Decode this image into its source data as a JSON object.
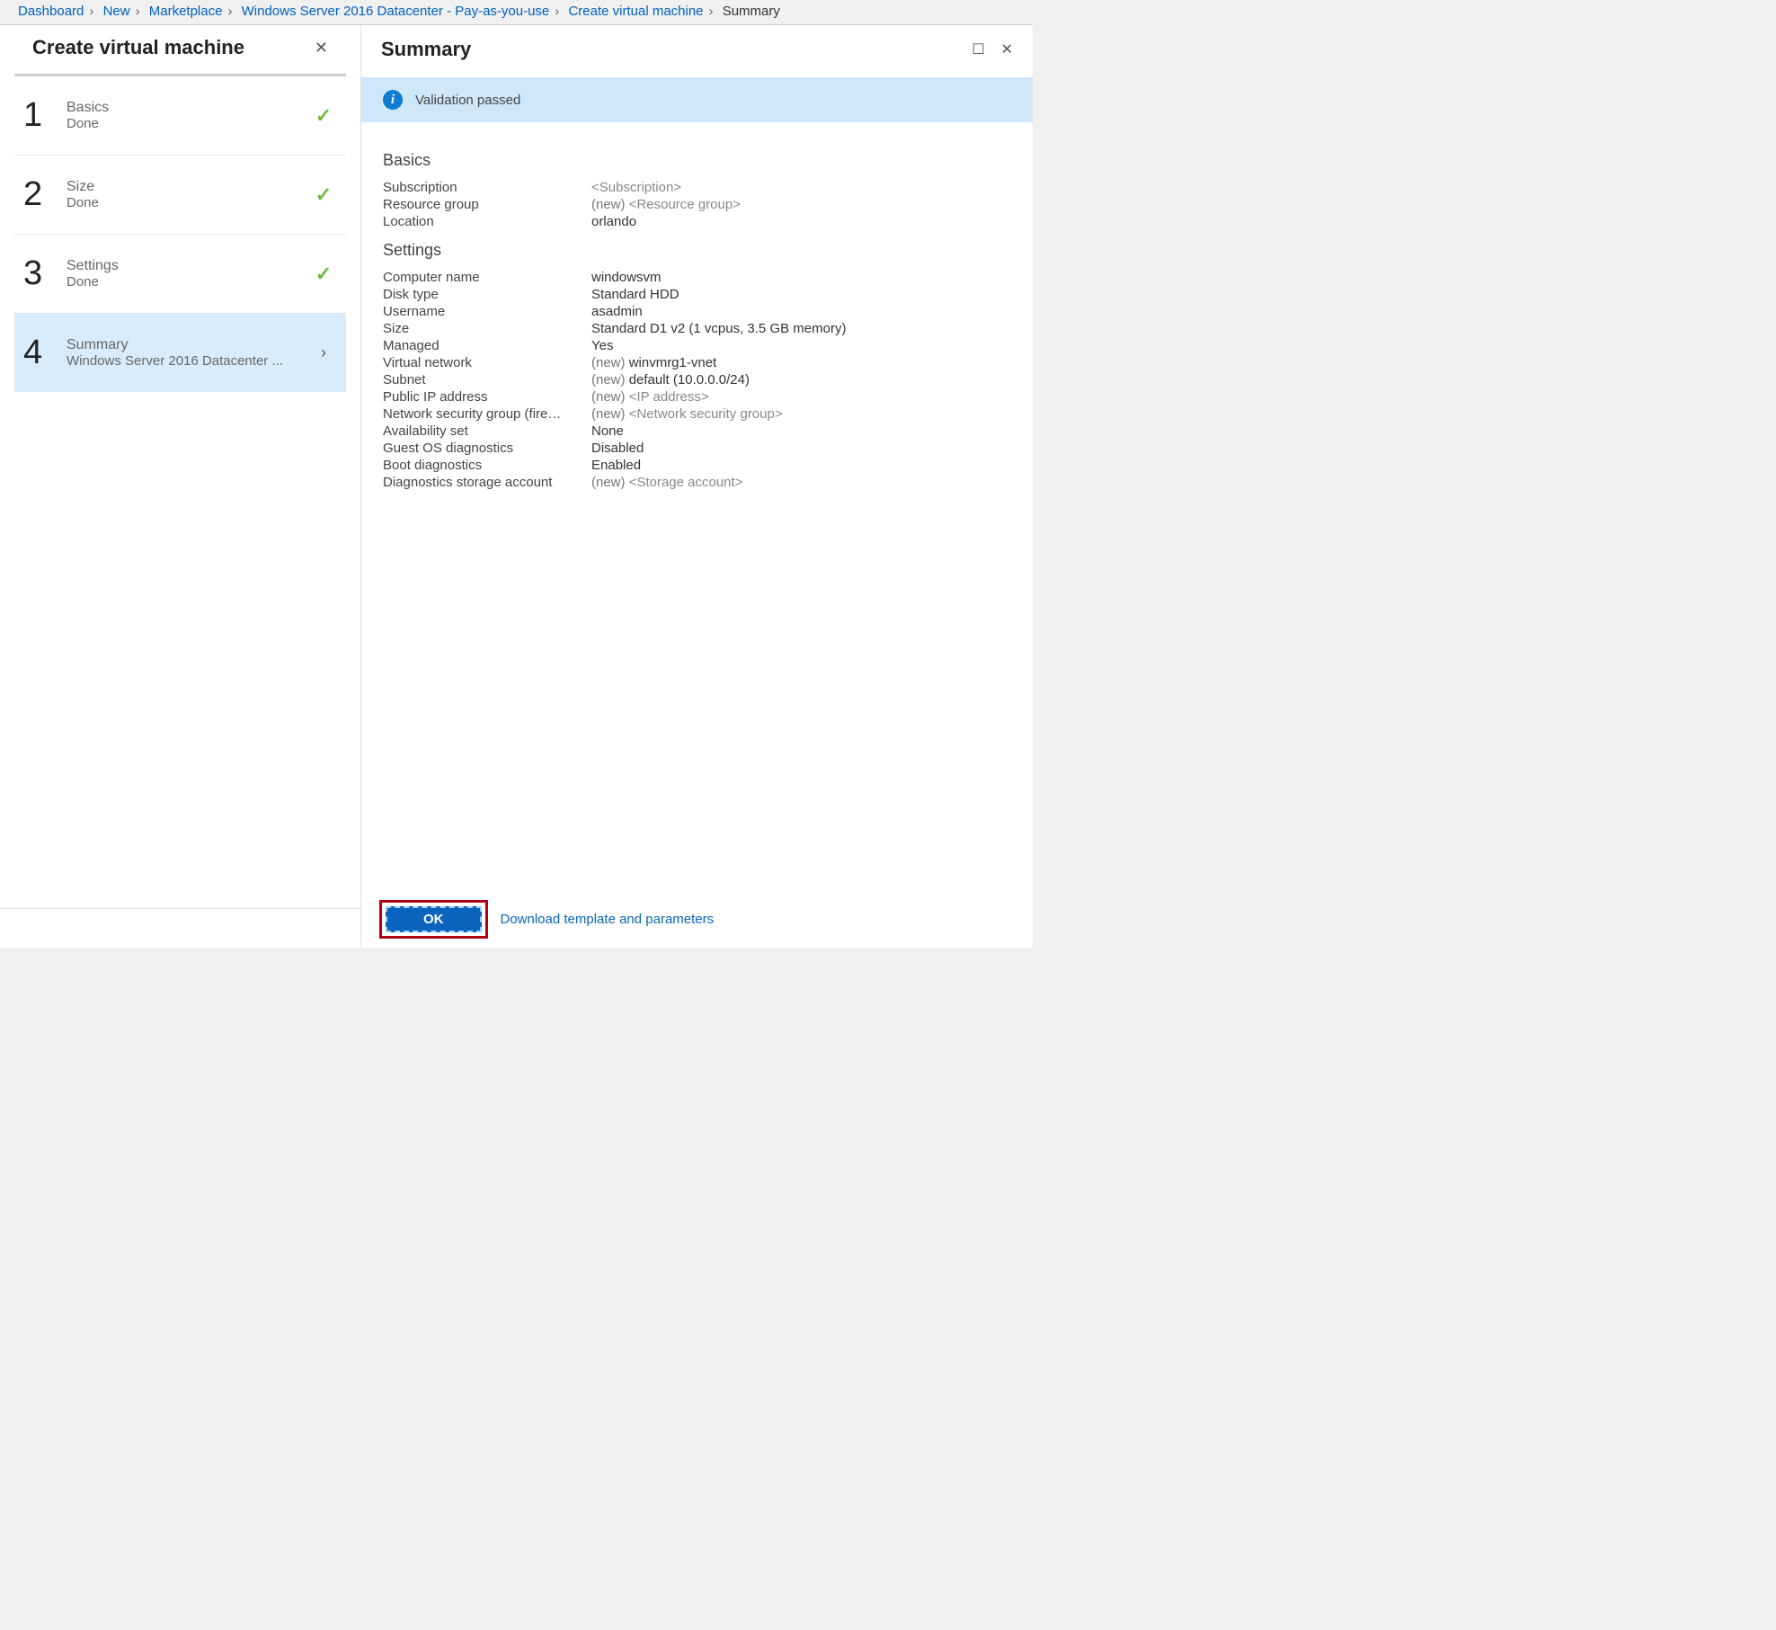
{
  "breadcrumb": {
    "items": [
      "Dashboard",
      "New",
      "Marketplace",
      "Windows Server 2016 Datacenter - Pay-as-you-use",
      "Create virtual machine"
    ],
    "current": "Summary"
  },
  "leftPanel": {
    "title": "Create virtual machine",
    "steps": [
      {
        "num": "1",
        "title": "Basics",
        "sub": "Done",
        "status": "done"
      },
      {
        "num": "2",
        "title": "Size",
        "sub": "Done",
        "status": "done"
      },
      {
        "num": "3",
        "title": "Settings",
        "sub": "Done",
        "status": "done"
      },
      {
        "num": "4",
        "title": "Summary",
        "sub": "Windows Server 2016 Datacenter ...",
        "status": "active"
      }
    ]
  },
  "rightPanel": {
    "title": "Summary",
    "validation": "Validation passed",
    "sections": {
      "basics": {
        "heading": "Basics",
        "rows": [
          {
            "k": "Subscription",
            "v": "<Subscription>",
            "muted": true
          },
          {
            "k": "Resource group",
            "pfx": "(new) ",
            "v": "<Resource group>",
            "muted": true
          },
          {
            "k": "Location",
            "v": "orlando"
          }
        ]
      },
      "settings": {
        "heading": "Settings",
        "rows": [
          {
            "k": "Computer name",
            "v": "windowsvm"
          },
          {
            "k": "Disk type",
            "v": "Standard HDD"
          },
          {
            "k": "Username",
            "v": "asadmin"
          },
          {
            "k": "Size",
            "v": "Standard D1 v2 (1 vcpus, 3.5 GB memory)"
          },
          {
            "k": "Managed",
            "v": "Yes"
          },
          {
            "k": "Virtual network",
            "pfx": "(new) ",
            "v": "winvmrg1-vnet"
          },
          {
            "k": "Subnet",
            "pfx": "(new) ",
            "v": "default (10.0.0.0/24)"
          },
          {
            "k": "Public IP address",
            "pfx": "(new) ",
            "v": "<IP address>",
            "muted": true
          },
          {
            "k": "Network security group (fire…",
            "pfx": "(new) ",
            "v": "<Network security group>",
            "muted": true
          },
          {
            "k": "Availability set",
            "v": "None"
          },
          {
            "k": "Guest OS diagnostics",
            "v": "Disabled"
          },
          {
            "k": "Boot diagnostics",
            "v": "Enabled"
          },
          {
            "k": "Diagnostics storage account",
            "pfx": "(new) ",
            "v": "<Storage account>",
            "muted": true
          }
        ]
      }
    },
    "footer": {
      "ok": "OK",
      "download": "Download template and parameters"
    }
  }
}
